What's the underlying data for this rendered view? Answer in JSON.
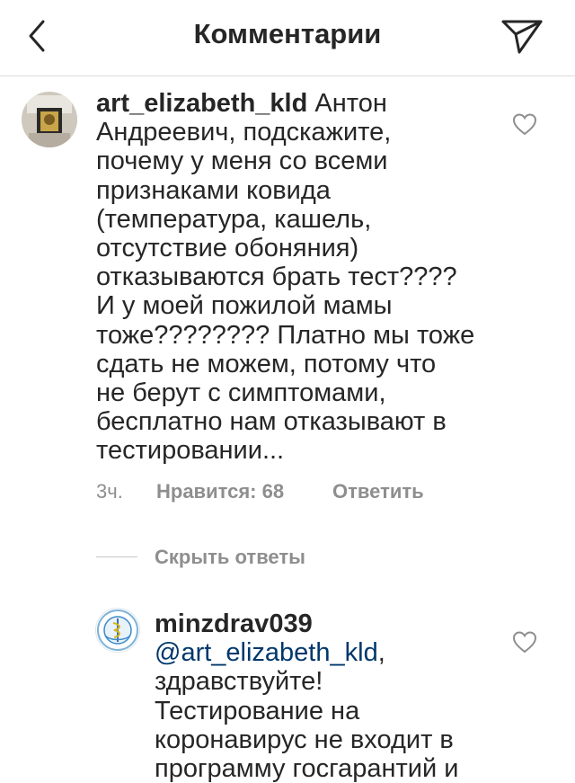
{
  "header": {
    "title": "Комментарии"
  },
  "comments": [
    {
      "username": "art_elizabeth_kld",
      "text": " Антон\nАндреевич, подскажите,\nпочему у меня со всеми\nпризнаками ковида\n(температура, кашель,\nотсутствие обоняния)\nотказываются брать тест????\nИ у моей пожилой мамы\nтоже???????? Платно мы тоже\nсдать не можем, потому что\nне берут с симптомами,\nбесплатно нам отказывают в\nтестировании...",
      "time": "3ч.",
      "likes": "Нравится: 68",
      "reply_label": "Ответить"
    }
  ],
  "hide_replies_label": "Скрыть ответы",
  "replies": [
    {
      "username": "minzdrav039",
      "mention": "@art_elizabeth_kld",
      "text": ",\nздравствуйте!\nТестирование на\nкоронавирус не входит в\nпрограмму госгарантий и"
    }
  ],
  "icons": {
    "back": "chevron-left-icon",
    "send": "paper-plane-icon",
    "like": "heart-outline-icon"
  }
}
